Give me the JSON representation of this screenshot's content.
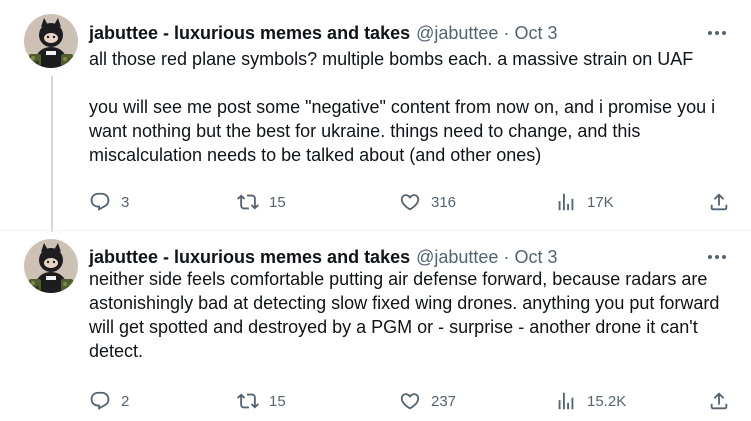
{
  "tweets": [
    {
      "display_name": "jabuttee - luxurious memes and takes",
      "handle": "@jabuttee",
      "separator": "·",
      "date": "Oct 3",
      "text": [
        "all those red plane symbols? multiple bombs each. a massive strain on UAF",
        "you will see me post some \"negative\" content from now on, and i promise you i want nothing but the best for ukraine. things need to change, and this miscalculation needs to be talked about (and other ones)"
      ],
      "replies": "3",
      "reposts": "15",
      "likes": "316",
      "views": "17K"
    },
    {
      "display_name": "jabuttee - luxurious memes and takes",
      "handle": "@jabuttee",
      "separator": "·",
      "date": "Oct 3",
      "text": [
        "neither side feels comfortable putting air defense forward, because radars are astonishingly bad at detecting slow fixed wing drones. anything you put forward will get spotted and destroyed by a PGM or - surprise - another drone it can't detect."
      ],
      "replies": "2",
      "reposts": "15",
      "likes": "237",
      "views": "15.2K"
    }
  ],
  "icons": {
    "more": "more-icon",
    "reply": "reply-icon",
    "repost": "repost-icon",
    "like": "like-icon",
    "views": "views-icon",
    "share": "share-icon"
  },
  "colors": {
    "primary_text": "#0f1419",
    "secondary_text": "#536471",
    "thread_line": "#cfd9de",
    "divider": "#eff3f4",
    "avatar_bg": "#cdc0b4"
  }
}
